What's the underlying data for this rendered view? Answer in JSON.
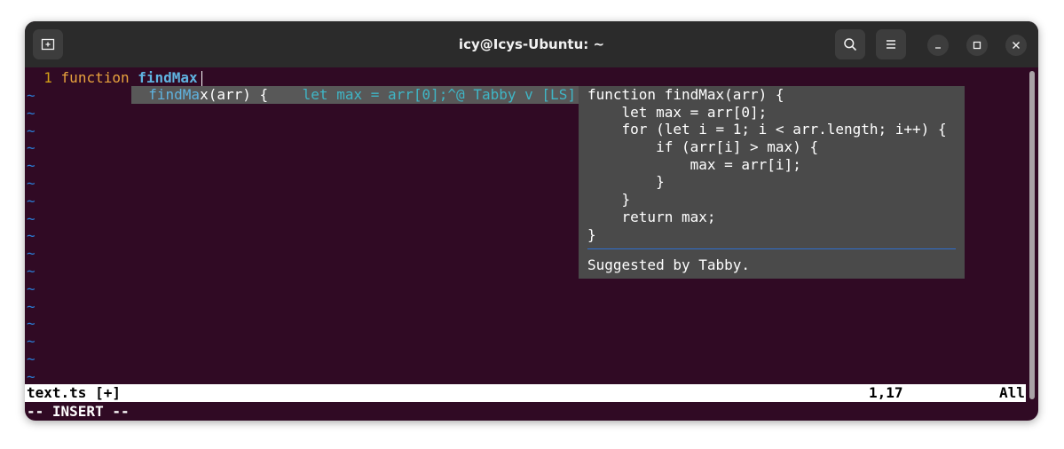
{
  "window": {
    "title": "icy@Icys-Ubuntu: ~",
    "new_tab_icon": "new-tab-icon",
    "search_icon": "search-icon",
    "menu_icon": "hamburger-menu-icon"
  },
  "editor": {
    "line_number": "1",
    "keyword": "function",
    "typed_name": "findMax",
    "tilde": "~",
    "tilde_count": 17
  },
  "popup": {
    "match_text": "findMa",
    "rest_text": "x(arr) {",
    "snippet_text": "let max = arr[0];^@",
    "source": "Tabby",
    "kind": "v",
    "tag": "[LS]"
  },
  "preview": {
    "lines": [
      "function findMax(arr) {",
      "    let max = arr[0];",
      "    for (let i = 1; i < arr.length; i++) {",
      "        if (arr[i] > max) {",
      "            max = arr[i];",
      "        }",
      "    }",
      "    return max;",
      "}"
    ],
    "footer": "Suggested by Tabby."
  },
  "status": {
    "filename": "text.ts [+]",
    "position": "1,17",
    "scroll": "All",
    "mode": "-- INSERT --"
  },
  "colors": {
    "terminal_bg": "#300a24",
    "titlebar_bg": "#2b2b2b",
    "line_number": "#d4a017",
    "keyword": "#e8a33d",
    "identifier": "#5fb3e0",
    "tilde": "#2a7ed8"
  }
}
